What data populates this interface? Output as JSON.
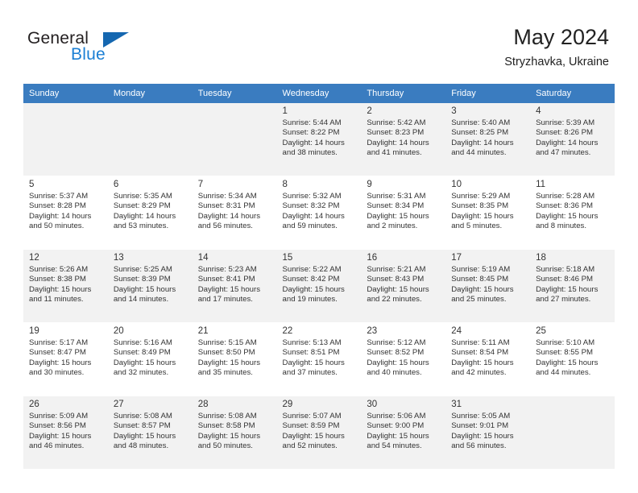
{
  "brand": {
    "name_part1": "General",
    "name_part2": "Blue",
    "flag_icon": "triangle-flag-icon"
  },
  "header": {
    "title": "May 2024",
    "subtitle": "Stryzhavka, Ukraine"
  },
  "colors": {
    "header_blue": "#3a7cc0",
    "brand_blue": "#1b7fd4",
    "shaded_cell": "#f2f2f2",
    "text": "#333333"
  },
  "weekday_headers": [
    "Sunday",
    "Monday",
    "Tuesday",
    "Wednesday",
    "Thursday",
    "Friday",
    "Saturday"
  ],
  "weeks": [
    [
      {
        "empty": true
      },
      {
        "empty": true
      },
      {
        "empty": true
      },
      {
        "day": "1",
        "sunrise": "Sunrise: 5:44 AM",
        "sunset": "Sunset: 8:22 PM",
        "daylight_line1": "Daylight: 14 hours",
        "daylight_line2": "and 38 minutes."
      },
      {
        "day": "2",
        "sunrise": "Sunrise: 5:42 AM",
        "sunset": "Sunset: 8:23 PM",
        "daylight_line1": "Daylight: 14 hours",
        "daylight_line2": "and 41 minutes."
      },
      {
        "day": "3",
        "sunrise": "Sunrise: 5:40 AM",
        "sunset": "Sunset: 8:25 PM",
        "daylight_line1": "Daylight: 14 hours",
        "daylight_line2": "and 44 minutes."
      },
      {
        "day": "4",
        "sunrise": "Sunrise: 5:39 AM",
        "sunset": "Sunset: 8:26 PM",
        "daylight_line1": "Daylight: 14 hours",
        "daylight_line2": "and 47 minutes."
      }
    ],
    [
      {
        "day": "5",
        "sunrise": "Sunrise: 5:37 AM",
        "sunset": "Sunset: 8:28 PM",
        "daylight_line1": "Daylight: 14 hours",
        "daylight_line2": "and 50 minutes."
      },
      {
        "day": "6",
        "sunrise": "Sunrise: 5:35 AM",
        "sunset": "Sunset: 8:29 PM",
        "daylight_line1": "Daylight: 14 hours",
        "daylight_line2": "and 53 minutes."
      },
      {
        "day": "7",
        "sunrise": "Sunrise: 5:34 AM",
        "sunset": "Sunset: 8:31 PM",
        "daylight_line1": "Daylight: 14 hours",
        "daylight_line2": "and 56 minutes."
      },
      {
        "day": "8",
        "sunrise": "Sunrise: 5:32 AM",
        "sunset": "Sunset: 8:32 PM",
        "daylight_line1": "Daylight: 14 hours",
        "daylight_line2": "and 59 minutes."
      },
      {
        "day": "9",
        "sunrise": "Sunrise: 5:31 AM",
        "sunset": "Sunset: 8:34 PM",
        "daylight_line1": "Daylight: 15 hours",
        "daylight_line2": "and 2 minutes."
      },
      {
        "day": "10",
        "sunrise": "Sunrise: 5:29 AM",
        "sunset": "Sunset: 8:35 PM",
        "daylight_line1": "Daylight: 15 hours",
        "daylight_line2": "and 5 minutes."
      },
      {
        "day": "11",
        "sunrise": "Sunrise: 5:28 AM",
        "sunset": "Sunset: 8:36 PM",
        "daylight_line1": "Daylight: 15 hours",
        "daylight_line2": "and 8 minutes."
      }
    ],
    [
      {
        "day": "12",
        "sunrise": "Sunrise: 5:26 AM",
        "sunset": "Sunset: 8:38 PM",
        "daylight_line1": "Daylight: 15 hours",
        "daylight_line2": "and 11 minutes."
      },
      {
        "day": "13",
        "sunrise": "Sunrise: 5:25 AM",
        "sunset": "Sunset: 8:39 PM",
        "daylight_line1": "Daylight: 15 hours",
        "daylight_line2": "and 14 minutes."
      },
      {
        "day": "14",
        "sunrise": "Sunrise: 5:23 AM",
        "sunset": "Sunset: 8:41 PM",
        "daylight_line1": "Daylight: 15 hours",
        "daylight_line2": "and 17 minutes."
      },
      {
        "day": "15",
        "sunrise": "Sunrise: 5:22 AM",
        "sunset": "Sunset: 8:42 PM",
        "daylight_line1": "Daylight: 15 hours",
        "daylight_line2": "and 19 minutes."
      },
      {
        "day": "16",
        "sunrise": "Sunrise: 5:21 AM",
        "sunset": "Sunset: 8:43 PM",
        "daylight_line1": "Daylight: 15 hours",
        "daylight_line2": "and 22 minutes."
      },
      {
        "day": "17",
        "sunrise": "Sunrise: 5:19 AM",
        "sunset": "Sunset: 8:45 PM",
        "daylight_line1": "Daylight: 15 hours",
        "daylight_line2": "and 25 minutes."
      },
      {
        "day": "18",
        "sunrise": "Sunrise: 5:18 AM",
        "sunset": "Sunset: 8:46 PM",
        "daylight_line1": "Daylight: 15 hours",
        "daylight_line2": "and 27 minutes."
      }
    ],
    [
      {
        "day": "19",
        "sunrise": "Sunrise: 5:17 AM",
        "sunset": "Sunset: 8:47 PM",
        "daylight_line1": "Daylight: 15 hours",
        "daylight_line2": "and 30 minutes."
      },
      {
        "day": "20",
        "sunrise": "Sunrise: 5:16 AM",
        "sunset": "Sunset: 8:49 PM",
        "daylight_line1": "Daylight: 15 hours",
        "daylight_line2": "and 32 minutes."
      },
      {
        "day": "21",
        "sunrise": "Sunrise: 5:15 AM",
        "sunset": "Sunset: 8:50 PM",
        "daylight_line1": "Daylight: 15 hours",
        "daylight_line2": "and 35 minutes."
      },
      {
        "day": "22",
        "sunrise": "Sunrise: 5:13 AM",
        "sunset": "Sunset: 8:51 PM",
        "daylight_line1": "Daylight: 15 hours",
        "daylight_line2": "and 37 minutes."
      },
      {
        "day": "23",
        "sunrise": "Sunrise: 5:12 AM",
        "sunset": "Sunset: 8:52 PM",
        "daylight_line1": "Daylight: 15 hours",
        "daylight_line2": "and 40 minutes."
      },
      {
        "day": "24",
        "sunrise": "Sunrise: 5:11 AM",
        "sunset": "Sunset: 8:54 PM",
        "daylight_line1": "Daylight: 15 hours",
        "daylight_line2": "and 42 minutes."
      },
      {
        "day": "25",
        "sunrise": "Sunrise: 5:10 AM",
        "sunset": "Sunset: 8:55 PM",
        "daylight_line1": "Daylight: 15 hours",
        "daylight_line2": "and 44 minutes."
      }
    ],
    [
      {
        "day": "26",
        "sunrise": "Sunrise: 5:09 AM",
        "sunset": "Sunset: 8:56 PM",
        "daylight_line1": "Daylight: 15 hours",
        "daylight_line2": "and 46 minutes."
      },
      {
        "day": "27",
        "sunrise": "Sunrise: 5:08 AM",
        "sunset": "Sunset: 8:57 PM",
        "daylight_line1": "Daylight: 15 hours",
        "daylight_line2": "and 48 minutes."
      },
      {
        "day": "28",
        "sunrise": "Sunrise: 5:08 AM",
        "sunset": "Sunset: 8:58 PM",
        "daylight_line1": "Daylight: 15 hours",
        "daylight_line2": "and 50 minutes."
      },
      {
        "day": "29",
        "sunrise": "Sunrise: 5:07 AM",
        "sunset": "Sunset: 8:59 PM",
        "daylight_line1": "Daylight: 15 hours",
        "daylight_line2": "and 52 minutes."
      },
      {
        "day": "30",
        "sunrise": "Sunrise: 5:06 AM",
        "sunset": "Sunset: 9:00 PM",
        "daylight_line1": "Daylight: 15 hours",
        "daylight_line2": "and 54 minutes."
      },
      {
        "day": "31",
        "sunrise": "Sunrise: 5:05 AM",
        "sunset": "Sunset: 9:01 PM",
        "daylight_line1": "Daylight: 15 hours",
        "daylight_line2": "and 56 minutes."
      },
      {
        "empty": true
      }
    ]
  ]
}
